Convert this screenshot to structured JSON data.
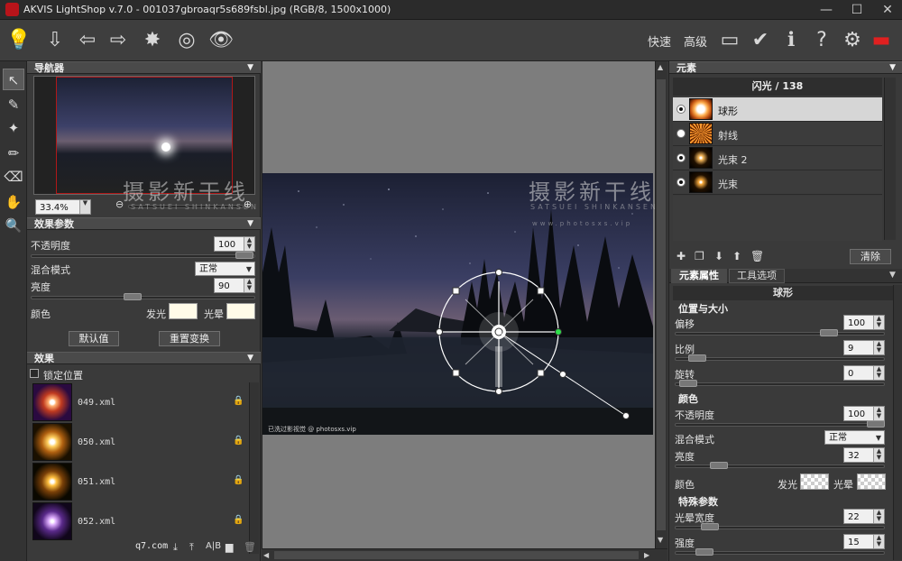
{
  "title_bar": {
    "title": "AKVIS LightShop v.7.0 - 001037gbroaqr5s689fsbl.jpg (RGB/8, 1500x1000)",
    "minimize": "—",
    "maximize": "☐",
    "close": "✕"
  },
  "toolbar": {
    "quick_label": "快速",
    "advanced_label": "高级"
  },
  "navigator": {
    "header": "导航器",
    "zoom_value": "33.4%"
  },
  "effect_params": {
    "header": "效果参数",
    "opacity_label": "不透明度",
    "opacity_value": "100",
    "blend_label": "混合模式",
    "blend_value": "正常",
    "brightness_label": "亮度",
    "brightness_value": "90",
    "color_label": "颜色",
    "glow_label": "发光",
    "halo_label": "光晕",
    "default_button": "默认值",
    "reset_button": "重置变换"
  },
  "effects": {
    "header": "效果",
    "lock_position_label": "锁定位置",
    "items": [
      {
        "name": "049.xml"
      },
      {
        "name": "050.xml"
      },
      {
        "name": "051.xml"
      },
      {
        "name": "052.xml"
      }
    ],
    "footer_site": "q7.com"
  },
  "elements": {
    "header": "元素",
    "flash_title": "闪光 / 138",
    "items": [
      {
        "name": "球形",
        "selected": true,
        "checked": true
      },
      {
        "name": "射线",
        "selected": false,
        "checked": false
      },
      {
        "name": "光束 2",
        "selected": false,
        "checked": true
      },
      {
        "name": "光束",
        "selected": false,
        "checked": true
      }
    ],
    "clear_button": "清除"
  },
  "element_props": {
    "tab_props": "元素属性",
    "tab_tools": "工具选项",
    "element_name": "球形",
    "pos_size_title": "位置与大小",
    "offset_label": "偏移",
    "offset_value": "100",
    "scale_label": "比例",
    "scale_value": "9",
    "rotate_label": "旋转",
    "rotate_value": "0",
    "color_title": "颜色",
    "opacity_label": "不透明度",
    "opacity_value": "100",
    "blend_label": "混合模式",
    "blend_value": "正常",
    "brightness_label": "亮度",
    "brightness_value": "32",
    "color_label": "颜色",
    "glow_label": "发光",
    "halo_label": "光晕",
    "special_title": "特殊参数",
    "halo_width_label": "光晕宽度",
    "halo_width_value": "22",
    "intensity_label": "强度",
    "intensity_value": "15"
  },
  "watermark": {
    "text": "摄影新干线",
    "sub": "SATSUEI SHINKANSEN",
    "url": "www.photosxs.vip"
  },
  "photo_caption": "已洗过影视觉 @ photosxs.vip"
}
